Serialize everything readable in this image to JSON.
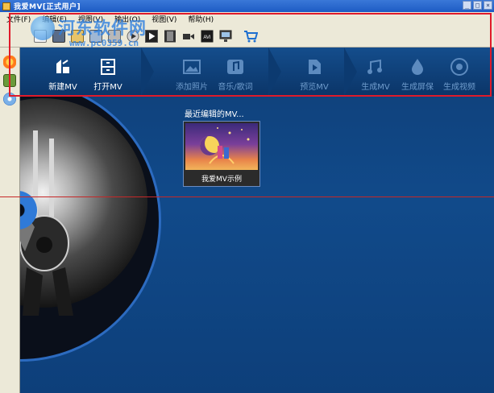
{
  "window": {
    "title": "我爱MV[正式用户]",
    "controls": [
      "_",
      "□",
      "×"
    ]
  },
  "menu": [
    "文件(F)",
    "编辑(E)",
    "视图(V)",
    "输出(O)",
    "视图(V)",
    "帮助(H)"
  ],
  "toolbar": {
    "icons": [
      "new-file-icon",
      "save-icon",
      "open-folder-icon",
      "image-icon",
      "music-icon",
      "play-circle-icon",
      "play-icon",
      "film-icon",
      "camera-icon",
      "avi-icon",
      "monitor-icon",
      "cart-icon"
    ],
    "avi_label": "AVI"
  },
  "watermark": {
    "text": "河东软件网",
    "url": "www.pc0359.cn"
  },
  "steps": [
    {
      "label": "新建MV",
      "icon": "new-mv-icon",
      "active": true
    },
    {
      "label": "打开MV",
      "icon": "open-mv-icon",
      "active": true
    },
    {
      "label": "添加照片",
      "icon": "add-photo-icon",
      "active": false
    },
    {
      "label": "音乐/歌词",
      "icon": "music-lyrics-icon",
      "active": false
    },
    {
      "label": "预览MV",
      "icon": "preview-icon",
      "active": false
    },
    {
      "label": "生成MV",
      "icon": "make-mv-icon",
      "active": false
    },
    {
      "label": "生成屏保",
      "icon": "screensaver-icon",
      "active": false
    },
    {
      "label": "生成视频",
      "icon": "make-video-icon",
      "active": false
    }
  ],
  "recent": {
    "title": "最近编辑的MV...",
    "items": [
      {
        "label": "我爱MV示例"
      }
    ]
  },
  "colors": {
    "accent_blue": "#2c6bc0",
    "highlight_red": "#e01a2a",
    "background": "#0d3d7a"
  }
}
